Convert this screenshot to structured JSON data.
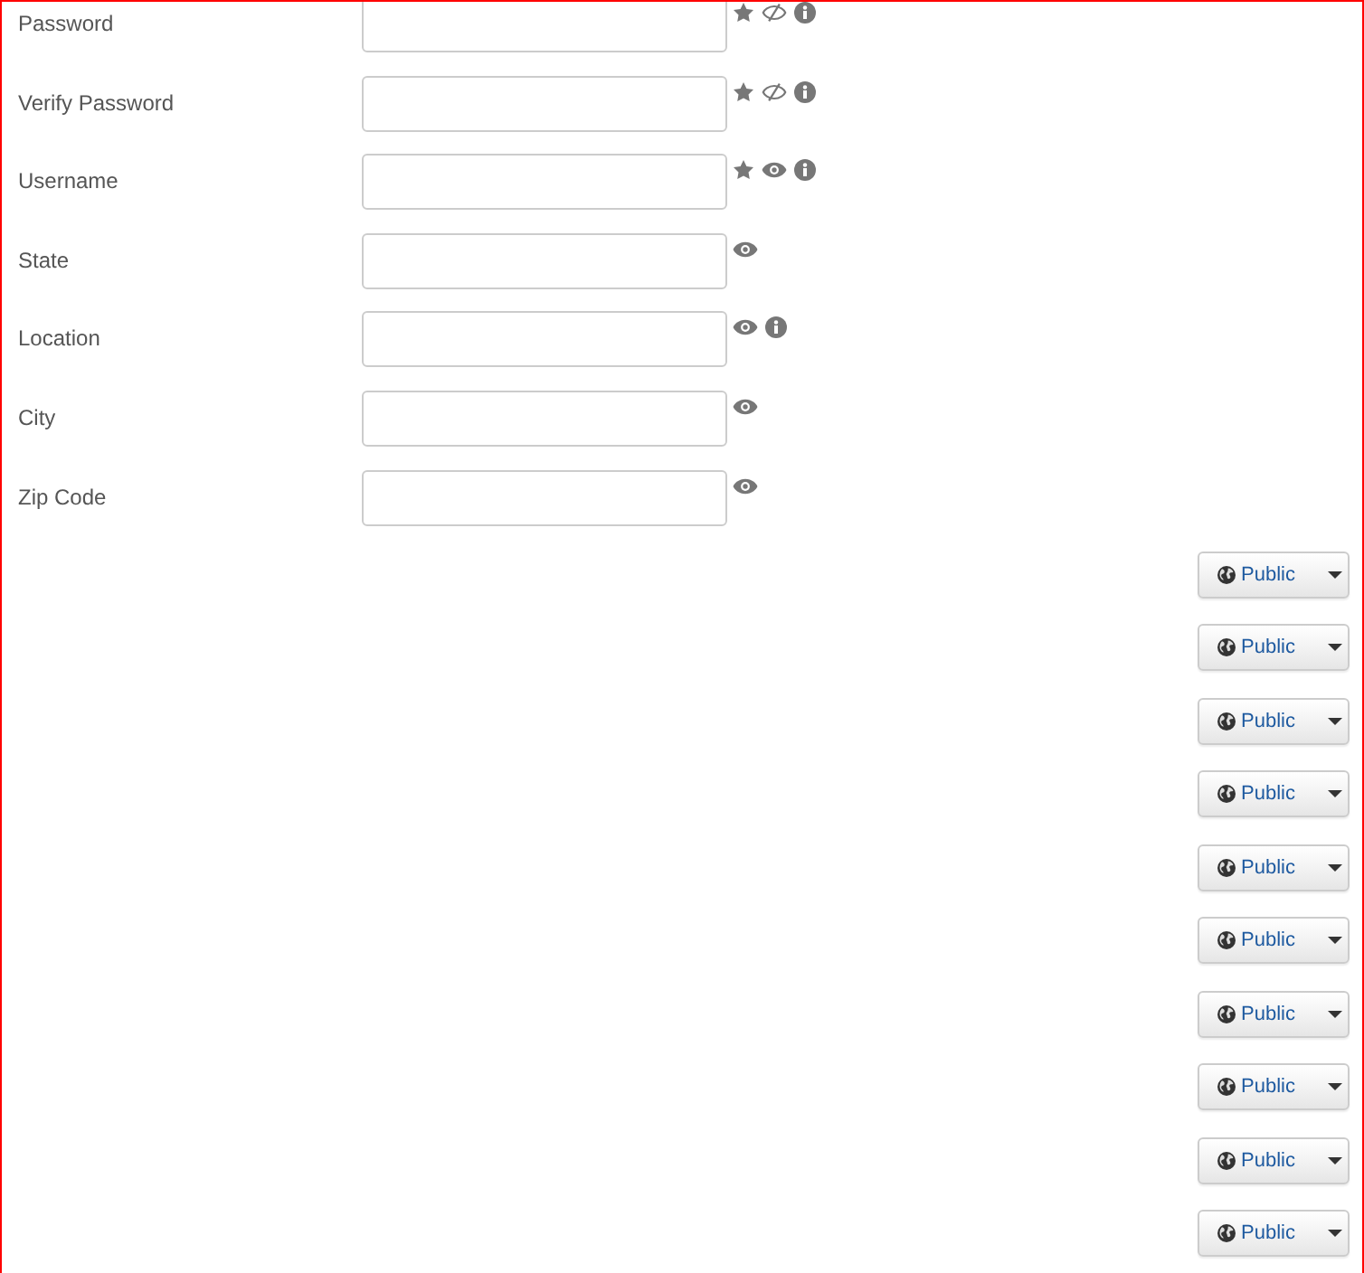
{
  "fields": [
    {
      "label": "Password",
      "required": true,
      "hidden": true,
      "info": true
    },
    {
      "label": "Verify Password",
      "required": true,
      "hidden": true,
      "info": true
    },
    {
      "label": "Username",
      "required": true,
      "hidden": false,
      "info": true
    },
    {
      "label": "State",
      "required": false,
      "hidden": false,
      "info": false
    },
    {
      "label": "Location",
      "required": false,
      "hidden": false,
      "info": true
    },
    {
      "label": "City",
      "required": false,
      "hidden": false,
      "info": false
    },
    {
      "label": "Zip Code",
      "required": false,
      "hidden": false,
      "info": false
    }
  ],
  "privacy_buttons": [
    {
      "label": "Public"
    },
    {
      "label": "Public"
    },
    {
      "label": "Public"
    },
    {
      "label": "Public"
    },
    {
      "label": "Public"
    },
    {
      "label": "Public"
    },
    {
      "label": "Public"
    },
    {
      "label": "Public"
    },
    {
      "label": "Public"
    },
    {
      "label": "Public"
    }
  ]
}
